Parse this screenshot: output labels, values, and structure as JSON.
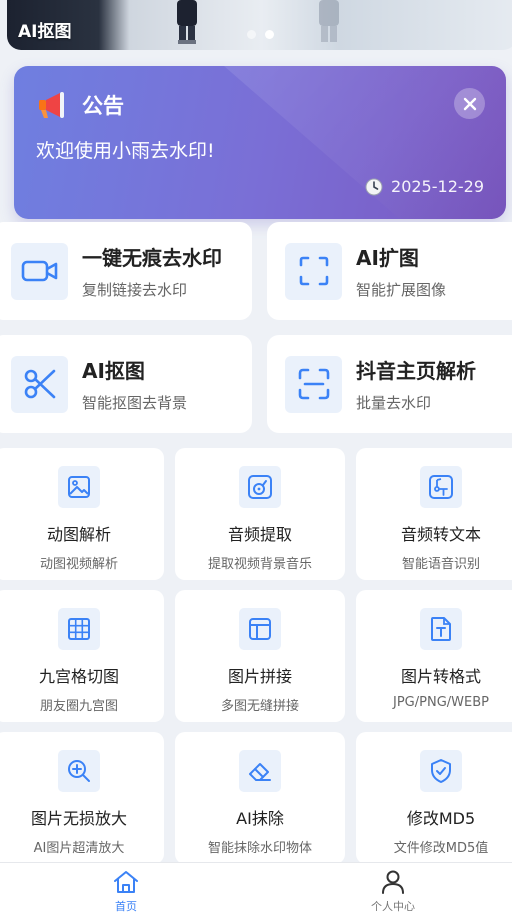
{
  "banner": {
    "title": "AI抠图",
    "slides": 2,
    "active_slide": 2
  },
  "notice": {
    "icon": "megaphone-icon",
    "title": "公告",
    "message": "欢迎使用小雨去水印!",
    "date": "2025-12-29",
    "close_icon": "close-icon",
    "clock_icon": "clock-icon"
  },
  "features_large": [
    {
      "title": "一键无痕去水印",
      "subtitle": "复制链接去水印",
      "icon": "video-camera-icon"
    },
    {
      "title": "AI扩图",
      "subtitle": "智能扩展图像",
      "icon": "expand-frame-icon"
    },
    {
      "title": "AI抠图",
      "subtitle": "智能抠图去背景",
      "icon": "scissors-icon"
    },
    {
      "title": "抖音主页解析",
      "subtitle": "批量去水印",
      "icon": "scan-icon"
    }
  ],
  "features_small": [
    {
      "title": "动图解析",
      "subtitle": "动图视频解析",
      "icon": "image-icon"
    },
    {
      "title": "音频提取",
      "subtitle": "提取视频背景音乐",
      "icon": "music-disc-icon"
    },
    {
      "title": "音频转文本",
      "subtitle": "智能语音识别",
      "icon": "music-text-icon"
    },
    {
      "title": "九宫格切图",
      "subtitle": "朋友圈九宫图",
      "icon": "grid-icon"
    },
    {
      "title": "图片拼接",
      "subtitle": "多图无缝拼接",
      "icon": "layout-icon"
    },
    {
      "title": "图片转格式",
      "subtitle": "JPG/PNG/WEBP",
      "icon": "file-type-icon"
    },
    {
      "title": "图片无损放大",
      "subtitle": "AI图片超清放大",
      "icon": "zoom-in-icon"
    },
    {
      "title": "AI抹除",
      "subtitle": "智能抹除水印物体",
      "icon": "eraser-icon"
    },
    {
      "title": "修改MD5",
      "subtitle": "文件修改MD5值",
      "icon": "shield-check-icon"
    }
  ],
  "tabbar": {
    "items": [
      {
        "label": "首页",
        "icon": "home-icon",
        "active": true
      },
      {
        "label": "个人中心",
        "icon": "user-icon",
        "active": false
      }
    ]
  },
  "colors": {
    "accent": "#3b82f6",
    "icon_bg": "#eaf1fb",
    "notice_start": "#6f7fe0",
    "notice_end": "#7b58c1",
    "inactive": "#777777"
  }
}
